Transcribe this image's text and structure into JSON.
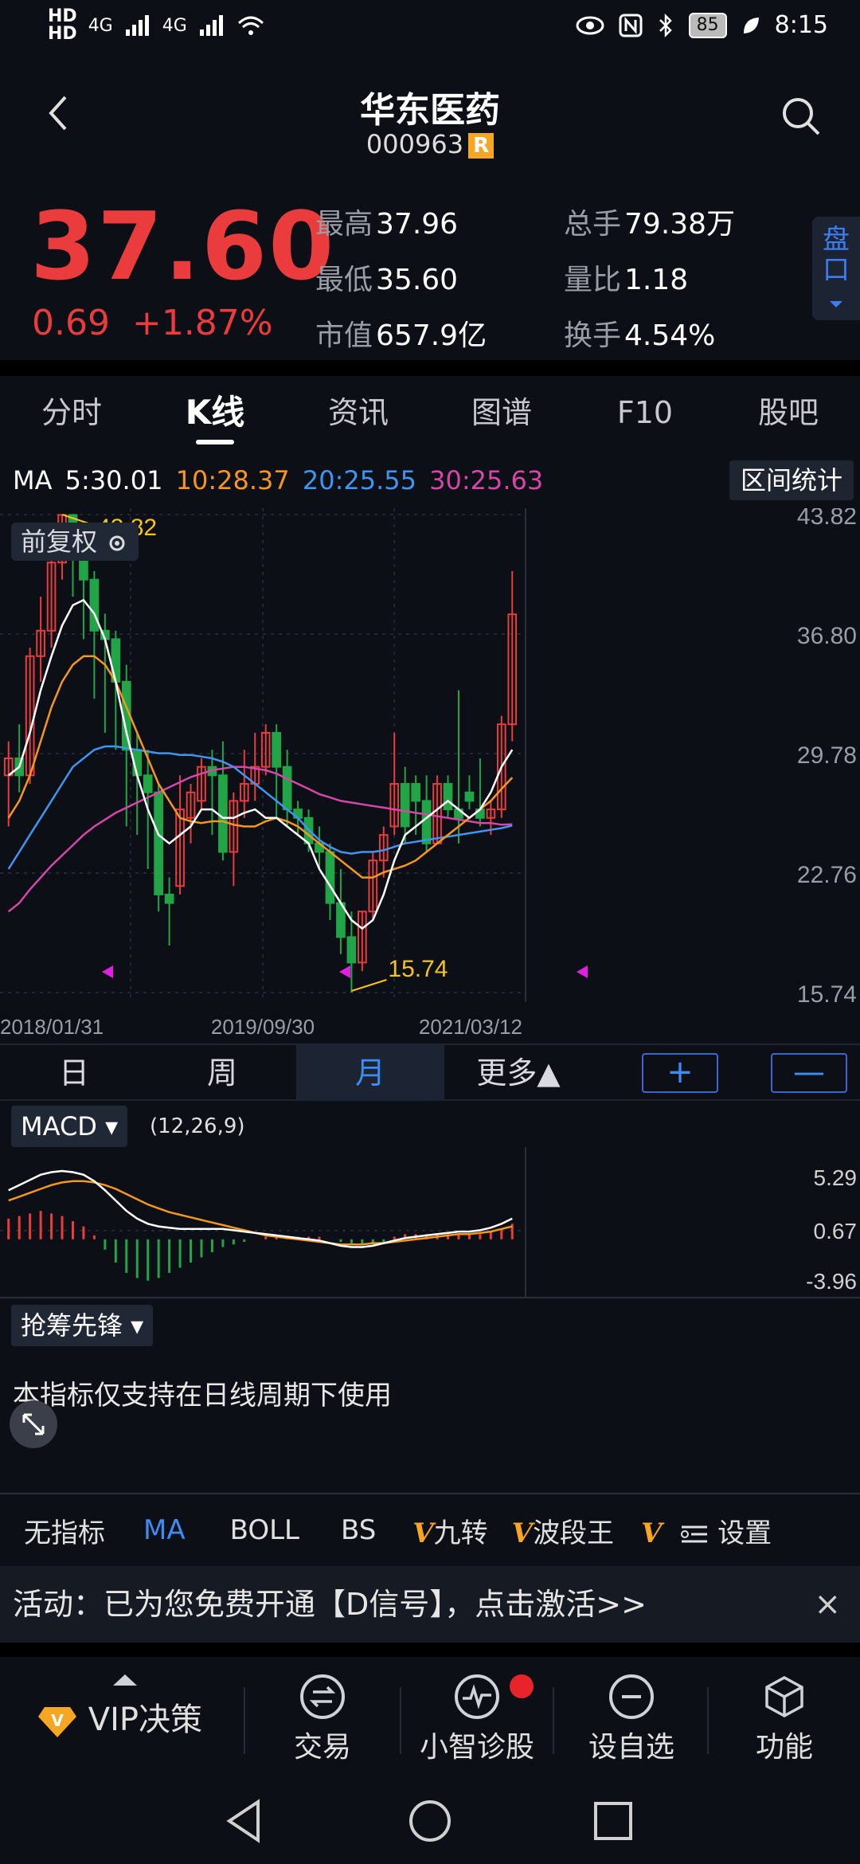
{
  "status_bar": {
    "sim1": "HD",
    "sim2": "HD",
    "signal1": "4G",
    "signal2": "4G",
    "battery": "85",
    "time": "8:15"
  },
  "header": {
    "title": "华东医药",
    "code": "000963",
    "badge": "R"
  },
  "quote": {
    "price": "37.60",
    "change": "0.69",
    "change_pct": "+1.87%",
    "high_label": "最高",
    "high": "37.96",
    "low_label": "最低",
    "low": "35.60",
    "cap_label": "市值",
    "cap": "657.9亿",
    "vol_label": "总手",
    "vol": "79.38万",
    "ratio_label": "量比",
    "ratio": "1.18",
    "turnover_label": "换手",
    "turnover": "4.54%",
    "pankou": "盘口"
  },
  "tabs": [
    "分时",
    "K线",
    "资讯",
    "图谱",
    "F10",
    "股吧"
  ],
  "ma": {
    "label": "MA",
    "ma5": "5:30.01",
    "ma10": "10:28.37",
    "ma20": "20:25.55",
    "ma30": "30:25.63",
    "range_btn": "区间统计"
  },
  "chart": {
    "fq_label": "前复权",
    "y_ticks": [
      "43.82",
      "36.80",
      "29.78",
      "22.76",
      "15.74"
    ],
    "x_ticks": [
      "2018/01/31",
      "2019/09/30",
      "2021/03/12"
    ],
    "max_label": "43.82",
    "min_label": "15.74"
  },
  "periods": [
    "日",
    "周",
    "月",
    "更多▲"
  ],
  "zoom": {
    "plus": "+",
    "minus": "—"
  },
  "macd": {
    "label": "MACD ▾",
    "params": "(12,26,9)",
    "y_ticks": [
      "5.29",
      "0.67",
      "-3.96"
    ]
  },
  "grab": {
    "label": "抢筹先锋 ▾",
    "note": "本指标仅支持在日线周期下使用"
  },
  "indicators": [
    "无指标",
    "MA",
    "BOLL",
    "BS",
    "九转",
    "波段王",
    "设置"
  ],
  "banner": {
    "text": "活动：已为您免费开通【D信号】，点击激活>>",
    "close": "×"
  },
  "bottom_nav": [
    "VIP决策",
    "交易",
    "小智诊股",
    "设自选",
    "功能"
  ],
  "colors": {
    "up": "#ea3b3d",
    "down": "#21a546",
    "ma5": "#ffffff",
    "ma10": "#f5961e",
    "ma20": "#3f95f0",
    "ma30": "#d446a8",
    "accent": "#3d8cf0"
  },
  "chart_data": {
    "type": "candlestick",
    "title": "",
    "period": "monthly",
    "ylim": [
      15.74,
      43.82
    ],
    "x_labels": [
      "2018/01/31",
      "2019/09/30",
      "2021/03/12"
    ],
    "candles": [
      [
        28.5,
        29.5,
        25.5,
        30.5
      ],
      [
        29.5,
        28.5,
        27.5,
        31.5
      ],
      [
        28.5,
        35.5,
        28.0,
        36.0
      ],
      [
        35.5,
        37.0,
        34.0,
        39.0
      ],
      [
        37.0,
        41.0,
        36.0,
        43.0
      ],
      [
        41.0,
        43.8,
        40.0,
        43.82
      ],
      [
        43.8,
        42.0,
        39.0,
        43.8
      ],
      [
        42.0,
        40.0,
        36.5,
        42.5
      ],
      [
        40.0,
        37.0,
        33.0,
        40.5
      ],
      [
        37.0,
        36.5,
        31.0,
        38.0
      ],
      [
        36.5,
        34.0,
        30.0,
        37.0
      ],
      [
        34.0,
        30.0,
        25.5,
        35.0
      ],
      [
        30.0,
        28.5,
        25.0,
        31.0
      ],
      [
        28.5,
        27.5,
        23.0,
        30.0
      ],
      [
        27.5,
        21.5,
        20.5,
        28.0
      ],
      [
        21.5,
        21.0,
        18.5,
        22.5
      ],
      [
        22.0,
        26.5,
        21.5,
        28.5
      ],
      [
        26.0,
        27.5,
        24.5,
        28.0
      ],
      [
        27.0,
        29.0,
        26.5,
        29.5
      ],
      [
        29.0,
        28.5,
        25.0,
        30.0
      ],
      [
        28.5,
        24.0,
        23.5,
        30.5
      ],
      [
        24.0,
        27.0,
        22.0,
        27.5
      ],
      [
        27.0,
        28.0,
        26.0,
        30.0
      ],
      [
        28.0,
        29.0,
        27.0,
        31.0
      ],
      [
        29.0,
        31.0,
        28.5,
        31.5
      ],
      [
        31.0,
        29.0,
        26.0,
        31.5
      ],
      [
        29.0,
        26.5,
        25.5,
        30.0
      ],
      [
        26.5,
        26.0,
        25.0,
        27.0
      ],
      [
        26.0,
        24.5,
        24.0,
        26.5
      ],
      [
        24.5,
        24.0,
        23.0,
        25.5
      ],
      [
        24.0,
        21.0,
        20.0,
        24.5
      ],
      [
        21.0,
        19.0,
        18.0,
        23.0
      ],
      [
        19.0,
        17.5,
        15.74,
        20.5
      ],
      [
        17.5,
        20.5,
        17.0,
        20.5
      ],
      [
        20.5,
        23.5,
        20.0,
        24.0
      ],
      [
        23.5,
        25.0,
        22.5,
        25.5
      ],
      [
        25.5,
        28.0,
        25.0,
        31.0
      ],
      [
        28.0,
        25.5,
        24.5,
        29.0
      ],
      [
        28.0,
        27.0,
        25.0,
        28.5
      ],
      [
        27.0,
        24.5,
        24.0,
        28.5
      ],
      [
        24.5,
        28.0,
        24.5,
        28.5
      ],
      [
        28.0,
        26.5,
        26.0,
        28.5
      ],
      [
        26.5,
        26.0,
        24.5,
        33.5
      ],
      [
        27.5,
        27.0,
        26.5,
        28.5
      ],
      [
        26.5,
        26.0,
        25.5,
        29.5
      ],
      [
        26.0,
        26.5,
        25.0,
        27.0
      ],
      [
        26.5,
        31.5,
        26.0,
        32.0
      ],
      [
        31.5,
        37.96,
        30.5,
        40.5
      ]
    ],
    "series_ma5": [
      28.5,
      29.0,
      31.0,
      33.5,
      35.5,
      37.3,
      38.5,
      38.8,
      38.0,
      36.5,
      34.0,
      31.0,
      28.5,
      26.5,
      25.0,
      24.5,
      25.0,
      25.5,
      26.5,
      26.5,
      26.0,
      26.0,
      26.3,
      26.5,
      26.0,
      26.0,
      25.5,
      25.0,
      24.5,
      23.0,
      22.0,
      21.0,
      20.0,
      19.5,
      20.0,
      21.5,
      23.5,
      25.0,
      25.5,
      26.0,
      26.5,
      27.0,
      26.5,
      26.0,
      26.5,
      27.5,
      29.0,
      30.01
    ],
    "series_ma10": [
      26.0,
      27.0,
      28.5,
      30.5,
      32.5,
      34.0,
      35.0,
      35.5,
      35.5,
      35.0,
      34.0,
      32.5,
      31.0,
      29.5,
      28.0,
      27.0,
      26.0,
      25.8,
      25.7,
      25.8,
      25.8,
      25.6,
      25.5,
      25.5,
      25.8,
      26.0,
      25.8,
      25.5,
      25.0,
      24.5,
      24.0,
      23.5,
      23.0,
      22.5,
      22.5,
      22.8,
      23.0,
      23.2,
      23.5,
      24.0,
      24.5,
      25.0,
      25.5,
      26.0,
      26.5,
      27.0,
      27.7,
      28.37
    ],
    "series_ma20": [
      23.0,
      24.0,
      25.0,
      26.0,
      27.0,
      28.0,
      29.0,
      29.5,
      30.0,
      30.2,
      30.2,
      30.1,
      30.0,
      29.9,
      29.8,
      29.8,
      29.7,
      29.7,
      29.6,
      29.5,
      29.3,
      29.0,
      28.5,
      28.0,
      27.5,
      27.0,
      26.5,
      26.0,
      25.3,
      24.7,
      24.3,
      24.0,
      23.9,
      24.0,
      24.0,
      24.1,
      24.3,
      24.5,
      24.6,
      24.7,
      24.8,
      24.9,
      25.0,
      25.1,
      25.2,
      25.3,
      25.4,
      25.55
    ],
    "series_ma30": [
      20.5,
      21.0,
      21.8,
      22.5,
      23.2,
      23.8,
      24.4,
      25.0,
      25.5,
      25.9,
      26.3,
      26.6,
      26.9,
      27.2,
      27.5,
      27.8,
      28.1,
      28.4,
      28.6,
      28.8,
      28.9,
      29.0,
      29.0,
      28.9,
      28.8,
      28.6,
      28.3,
      28.0,
      27.7,
      27.4,
      27.2,
      27.0,
      26.9,
      26.8,
      26.7,
      26.6,
      26.5,
      26.4,
      26.3,
      26.2,
      26.1,
      26.0,
      25.9,
      25.8,
      25.7,
      25.7,
      25.6,
      25.63
    ],
    "macd": {
      "ylim": [
        -3.96,
        5.29
      ],
      "dif": [
        3.8,
        4.2,
        4.6,
        5.0,
        5.2,
        5.29,
        5.2,
        5.0,
        4.5,
        3.8,
        3.0,
        2.2,
        1.6,
        1.2,
        1.0,
        0.9,
        0.8,
        0.8,
        0.8,
        0.8,
        0.8,
        0.7,
        0.6,
        0.5,
        0.4,
        0.3,
        0.2,
        0.1,
        0.0,
        -0.1,
        -0.3,
        -0.5,
        -0.6,
        -0.6,
        -0.5,
        -0.3,
        -0.1,
        0.1,
        0.2,
        0.3,
        0.4,
        0.5,
        0.6,
        0.6,
        0.7,
        0.9,
        1.2,
        1.6
      ],
      "dea": [
        3.0,
        3.3,
        3.6,
        3.9,
        4.2,
        4.4,
        4.5,
        4.5,
        4.4,
        4.2,
        3.9,
        3.5,
        3.1,
        2.7,
        2.4,
        2.1,
        1.9,
        1.7,
        1.5,
        1.3,
        1.1,
        0.9,
        0.7,
        0.5,
        0.3,
        0.2,
        0.1,
        0.0,
        -0.1,
        -0.2,
        -0.3,
        -0.4,
        -0.4,
        -0.4,
        -0.3,
        -0.3,
        -0.2,
        -0.1,
        0.0,
        0.1,
        0.2,
        0.3,
        0.4,
        0.4,
        0.5,
        0.6,
        0.8,
        1.0
      ],
      "hist": [
        1.6,
        1.8,
        2.0,
        2.2,
        2.0,
        1.8,
        1.4,
        1.0,
        0.3,
        -0.8,
        -1.8,
        -2.6,
        -3.0,
        -3.2,
        -3.0,
        -2.6,
        -2.2,
        -1.8,
        -1.4,
        -1.0,
        -0.6,
        -0.4,
        -0.2,
        0.0,
        0.2,
        0.2,
        0.2,
        0.2,
        0.2,
        0.2,
        0.0,
        -0.2,
        -0.4,
        -0.4,
        -0.4,
        -0.2,
        0.2,
        0.4,
        0.4,
        0.4,
        0.4,
        0.4,
        0.4,
        0.4,
        0.4,
        0.6,
        0.8,
        1.2
      ]
    }
  }
}
